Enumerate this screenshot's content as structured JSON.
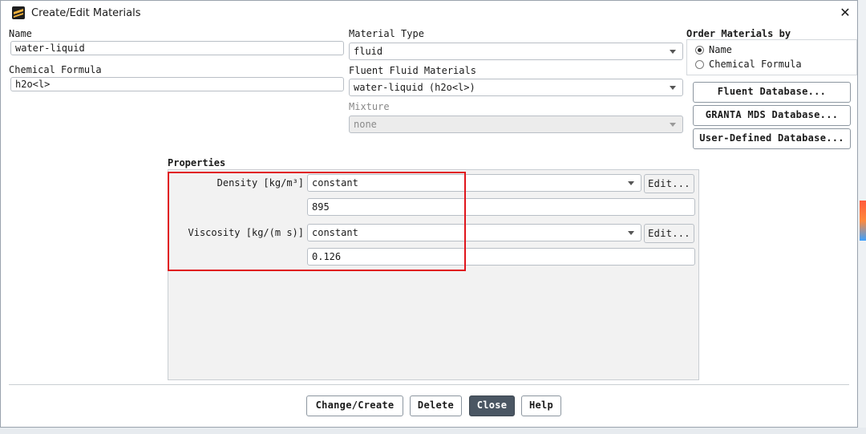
{
  "window": {
    "title": "Create/Edit Materials"
  },
  "name": {
    "label": "Name",
    "value": "water-liquid"
  },
  "chemical_formula": {
    "label": "Chemical Formula",
    "value": "h2o<l>"
  },
  "material_type": {
    "label": "Material Type",
    "value": "fluid"
  },
  "fluent_fluid_materials": {
    "label": "Fluent Fluid Materials",
    "value": "water-liquid (h2o<l>)"
  },
  "mixture": {
    "label": "Mixture",
    "value": "none"
  },
  "order_by": {
    "label": "Order Materials by",
    "options": [
      "Name",
      "Chemical Formula"
    ],
    "selected": "Name"
  },
  "database_buttons": {
    "fluent": "Fluent Database...",
    "granta": "GRANTA MDS Database...",
    "user": "User-Defined Database..."
  },
  "properties": {
    "title": "Properties",
    "density": {
      "label": "Density [kg/m³]",
      "method": "constant",
      "value": "895",
      "edit": "Edit..."
    },
    "viscosity": {
      "label": "Viscosity [kg/(m s)]",
      "method": "constant",
      "value": "0.126",
      "edit": "Edit..."
    }
  },
  "footer": {
    "change_create": "Change/Create",
    "delete": "Delete",
    "close": "Close",
    "help": "Help"
  },
  "colors": {
    "highlight": "#e0151c",
    "primary_button": "#4a5663"
  }
}
